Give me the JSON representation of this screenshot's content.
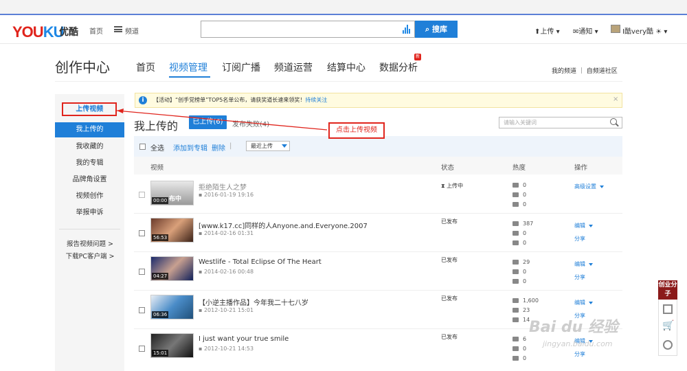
{
  "header": {
    "logo": "YOUKU",
    "logo_cn": "优酷",
    "home": "首页",
    "channels": "频道",
    "search_button": "搜库",
    "upload": "上传",
    "notify": "通知",
    "user": "I酷very酷"
  },
  "page": {
    "title": "创作中心",
    "tabs": [
      "首页",
      "视频管理",
      "订阅广播",
      "频道运营",
      "结算中心",
      "数据分析"
    ],
    "new_badge": "新",
    "right_links": "我的频道 ｜ 自频道社区"
  },
  "sidebar": {
    "items": [
      "上传视频",
      "我上传的",
      "我收藏的",
      "我的专辑",
      "品牌角设置",
      "视频创作",
      "举报申诉"
    ],
    "links": [
      "报告视频问题 >",
      "下载PC客户端 >"
    ]
  },
  "notice": {
    "text": "【活动】“创手党榜单”TOP5名单公布，请获奖道长速来领奖！",
    "link": "持续关注",
    "close": "×"
  },
  "list": {
    "title": "我上传的",
    "tab_uploaded": "已上传(6)",
    "tab_failed": "发布失败(4)",
    "keyword_placeholder": "请输入关键词",
    "select_all": "全选",
    "add_to_album": "添加到专辑",
    "delete": "删除",
    "sort": "最近上传",
    "col_video": "视频",
    "col_status": "状态",
    "col_heat": "热度",
    "col_ops": "操作"
  },
  "videos": [
    {
      "title": "拒绝陌生人之梦",
      "date": "2016-01-19 19:16",
      "duration": "00:00",
      "thumb_text": "布中",
      "status": "上传中",
      "plays": "0",
      "comments": "0",
      "favs": "0",
      "op1": "高级设置",
      "op2": ""
    },
    {
      "title": "[www.k17.cc]同样的人Anyone.and.Everyone.2007",
      "date": "2014-02-16 01:31",
      "duration": "56:53",
      "thumb_text": "",
      "status": "已发布",
      "plays": "387",
      "comments": "0",
      "favs": "0",
      "op1": "编辑",
      "op2": "分享"
    },
    {
      "title": "Westlife - Total Eclipse Of The Heart",
      "date": "2014-02-16 00:48",
      "duration": "04:27",
      "thumb_text": "",
      "status": "已发布",
      "plays": "29",
      "comments": "0",
      "favs": "0",
      "op1": "编辑",
      "op2": "分享"
    },
    {
      "title": "【小逆主播作品】今年我二十七八岁",
      "date": "2012-10-21 15:01",
      "duration": "06:36",
      "thumb_text": "",
      "status": "已发布",
      "plays": "1,600",
      "comments": "23",
      "favs": "14",
      "op1": "编辑",
      "op2": "分享"
    },
    {
      "title": "I just want your true smile",
      "date": "2012-10-21 14:53",
      "duration": "15:01",
      "thumb_text": "",
      "status": "已发布",
      "plays": "6",
      "comments": "0",
      "favs": "0",
      "op1": "编辑",
      "op2": "分享"
    }
  ],
  "annotation": {
    "box_label": "上传视频",
    "callout": "点击上传视频"
  },
  "float_panel": {
    "top": "创业分子"
  },
  "watermark": {
    "line1": "Bai du 经验",
    "line2": "jingyan.baidu.com"
  },
  "colors": {
    "accent": "#1f7fd8",
    "annotation": "#e0241c"
  }
}
